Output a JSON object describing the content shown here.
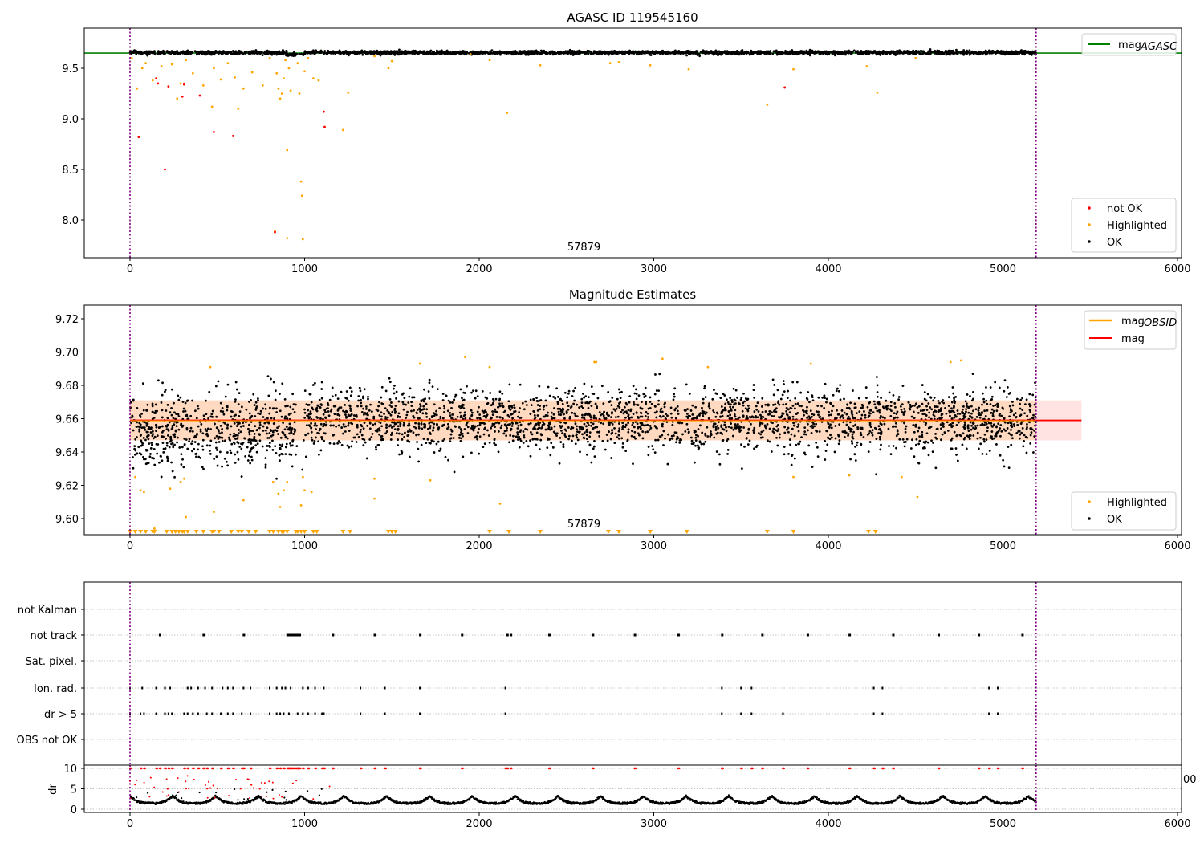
{
  "chart_data": [
    {
      "type": "scatter",
      "title": "AGASC ID 119545160",
      "annotation": "57879",
      "xlim": [
        -260,
        6010
      ],
      "ylim": [
        7.627,
        9.897
      ],
      "xticks": [
        "0",
        "1000",
        "2000",
        "3000",
        "4000",
        "5000",
        "6000"
      ],
      "yticks": [
        "8.0",
        "8.5",
        "9.0",
        "9.5"
      ],
      "ytick_values": [
        8.0,
        8.5,
        9.0,
        9.5
      ],
      "vlines": [
        0,
        5190
      ],
      "hline": {
        "value": 9.65,
        "color": "#008000",
        "label": "mag",
        "label_sub": "AGASC"
      },
      "legend": [
        {
          "label": "not OK",
          "color": "#ff0000"
        },
        {
          "label": "Highlighted",
          "color": "#ffa500"
        },
        {
          "label": "OK",
          "color": "#000000"
        }
      ],
      "ok_series": {
        "x_range": [
          0,
          5190
        ],
        "gap": [
          950,
          1000
        ],
        "mean": 9.655,
        "std": 0.009,
        "count": 2600
      },
      "not_ok_points": [
        [
          50,
          8.82
        ],
        [
          150,
          9.4
        ],
        [
          160,
          9.35
        ],
        [
          200,
          8.5
        ],
        [
          220,
          9.32
        ],
        [
          300,
          9.22
        ],
        [
          310,
          9.34
        ],
        [
          400,
          9.23
        ],
        [
          480,
          8.87
        ],
        [
          590,
          8.83
        ],
        [
          830,
          7.88
        ],
        [
          1110,
          9.07
        ],
        [
          1115,
          8.92
        ],
        [
          3750,
          9.31
        ]
      ],
      "highlighted_points": [
        [
          10,
          9.6
        ],
        [
          40,
          9.3
        ],
        [
          70,
          9.5
        ],
        [
          90,
          9.55
        ],
        [
          130,
          9.38
        ],
        [
          180,
          9.52
        ],
        [
          240,
          9.54
        ],
        [
          270,
          9.2
        ],
        [
          290,
          9.35
        ],
        [
          320,
          9.58
        ],
        [
          360,
          9.45
        ],
        [
          420,
          9.33
        ],
        [
          470,
          9.12
        ],
        [
          480,
          9.5
        ],
        [
          520,
          9.39
        ],
        [
          560,
          9.55
        ],
        [
          600,
          9.41
        ],
        [
          620,
          9.1
        ],
        [
          650,
          9.3
        ],
        [
          700,
          9.46
        ],
        [
          760,
          9.33
        ],
        [
          800,
          9.6
        ],
        [
          830,
          7.89
        ],
        [
          840,
          9.45
        ],
        [
          850,
          9.3
        ],
        [
          860,
          9.2
        ],
        [
          870,
          9.25
        ],
        [
          880,
          9.4
        ],
        [
          890,
          9.58
        ],
        [
          900,
          8.69
        ],
        [
          900,
          7.82
        ],
        [
          910,
          9.5
        ],
        [
          920,
          9.28
        ],
        [
          960,
          9.55
        ],
        [
          970,
          9.25
        ],
        [
          980,
          8.38
        ],
        [
          985,
          8.24
        ],
        [
          990,
          7.81
        ],
        [
          1000,
          9.47
        ],
        [
          1020,
          9.6
        ],
        [
          1050,
          9.4
        ],
        [
          1080,
          9.38
        ],
        [
          1220,
          8.89
        ],
        [
          1250,
          9.26
        ],
        [
          1400,
          9.62
        ],
        [
          1480,
          9.5
        ],
        [
          1500,
          9.57
        ],
        [
          1950,
          9.64
        ],
        [
          2060,
          9.58
        ],
        [
          2160,
          9.06
        ],
        [
          2350,
          9.53
        ],
        [
          2750,
          9.55
        ],
        [
          2800,
          9.56
        ],
        [
          2980,
          9.53
        ],
        [
          3200,
          9.49
        ],
        [
          3650,
          9.14
        ],
        [
          3800,
          9.49
        ],
        [
          4220,
          9.52
        ],
        [
          4280,
          9.26
        ],
        [
          4500,
          9.6
        ]
      ]
    },
    {
      "type": "scatter",
      "title": "Magnitude Estimates",
      "annotation": "57879",
      "xlim": [
        -260,
        6010
      ],
      "ylim": [
        9.5904,
        9.728
      ],
      "xticks": [
        "0",
        "1000",
        "2000",
        "3000",
        "4000",
        "5000",
        "6000"
      ],
      "yticks": [
        "9.60",
        "9.62",
        "9.64",
        "9.66",
        "9.68",
        "9.70",
        "9.72"
      ],
      "ytick_values": [
        9.6,
        9.62,
        9.64,
        9.66,
        9.68,
        9.7,
        9.72
      ],
      "vlines": [
        0,
        5190
      ],
      "mag_line": {
        "value": 9.659,
        "band": [
          9.647,
          9.671
        ],
        "x_end": 5450,
        "color": "#ff0000",
        "label": "mag"
      },
      "mag_obsid": {
        "band": [
          9.647,
          9.671
        ],
        "x_end": 5190,
        "color": "#ffa500",
        "label": "mag",
        "label_sub": "OBSID"
      },
      "legend": [
        {
          "label": "Highlighted",
          "color": "#ffa500"
        },
        {
          "label": "OK",
          "color": "#000000"
        }
      ],
      "ok_series": {
        "x_range": [
          0,
          5190
        ],
        "gap": [
          950,
          1000
        ],
        "mean": 9.659,
        "std": 0.0095,
        "early_mean": 9.653,
        "early_end": 1000,
        "count": 3200
      },
      "highlighted_points": [
        [
          30,
          9.625
        ],
        [
          60,
          9.617
        ],
        [
          80,
          9.616
        ],
        [
          140,
          9.594
        ],
        [
          230,
          9.618
        ],
        [
          290,
          9.622
        ],
        [
          310,
          9.624
        ],
        [
          320,
          9.601
        ],
        [
          460,
          9.691
        ],
        [
          480,
          9.604
        ],
        [
          650,
          9.611
        ],
        [
          820,
          9.622
        ],
        [
          850,
          9.615
        ],
        [
          860,
          9.607
        ],
        [
          880,
          9.617
        ],
        [
          900,
          9.622
        ],
        [
          980,
          9.608
        ],
        [
          990,
          9.625
        ],
        [
          1000,
          9.617
        ],
        [
          1040,
          9.616
        ],
        [
          1400,
          9.612
        ],
        [
          1400,
          9.624
        ],
        [
          1660,
          9.693
        ],
        [
          1720,
          9.623
        ],
        [
          1920,
          9.697
        ],
        [
          2060,
          9.691
        ],
        [
          2120,
          9.609
        ],
        [
          2660,
          9.694
        ],
        [
          2670,
          9.694
        ],
        [
          3050,
          9.696
        ],
        [
          3310,
          9.691
        ],
        [
          3900,
          9.693
        ],
        [
          3800,
          9.625
        ],
        [
          4120,
          9.626
        ],
        [
          4420,
          9.625
        ],
        [
          4510,
          9.613
        ],
        [
          4700,
          9.694
        ],
        [
          4760,
          9.695
        ]
      ],
      "clipped_below_x": [
        0,
        30,
        60,
        90,
        130,
        140,
        210,
        240,
        260,
        280,
        300,
        310,
        330,
        380,
        420,
        470,
        480,
        510,
        580,
        620,
        640,
        680,
        720,
        800,
        820,
        850,
        870,
        880,
        900,
        950,
        960,
        980,
        1000,
        1050,
        1070,
        1220,
        1260,
        1480,
        1500,
        1520,
        2060,
        2170,
        2350,
        2740,
        2800,
        2980,
        3190,
        3650,
        3800,
        4230,
        4270
      ]
    },
    {
      "type": "scatter",
      "categories": [
        "not Kalman",
        "not track",
        "Sat. pixel.",
        "Ion. rad.",
        "dr > 5",
        "OBS not OK"
      ],
      "xlim": [
        -260,
        6010
      ],
      "vlines": [
        0,
        5190
      ],
      "flags": {
        "not track": [
          170,
          420,
          650,
          900,
          910,
          920,
          930,
          940,
          950,
          960,
          970,
          1160,
          1400,
          1660,
          1900,
          2160,
          2180,
          2400,
          2650,
          2890,
          3140,
          3390,
          3620,
          3880,
          4120,
          4370,
          4630,
          4860,
          5110
        ],
        "Ion. rad.": [
          0,
          70,
          150,
          200,
          230,
          330,
          350,
          390,
          430,
          470,
          530,
          560,
          590,
          650,
          690,
          800,
          840,
          870,
          890,
          920,
          990,
          1020,
          1060,
          1110,
          1320,
          1460,
          1660,
          2150,
          3390,
          3500,
          3560,
          4260,
          4310,
          4920,
          4970
        ],
        "dr > 5": [
          0,
          60,
          80,
          150,
          200,
          220,
          240,
          310,
          330,
          360,
          390,
          440,
          470,
          520,
          560,
          590,
          640,
          690,
          800,
          840,
          860,
          880,
          910,
          960,
          990,
          1020,
          1060,
          1100,
          1110,
          1320,
          1460,
          1660,
          2150,
          3390,
          3500,
          3560,
          3740,
          4260,
          4310,
          4920,
          4970
        ]
      },
      "dr_panel": {
        "ylabel": "dr",
        "yticks": [
          "0",
          "5",
          "10"
        ],
        "ytick_values": [
          0,
          5,
          10
        ],
        "ylim": [
          -0.8,
          11.5
        ],
        "clip_value": 10,
        "period": 245,
        "cut_label": "00"
      }
    }
  ]
}
